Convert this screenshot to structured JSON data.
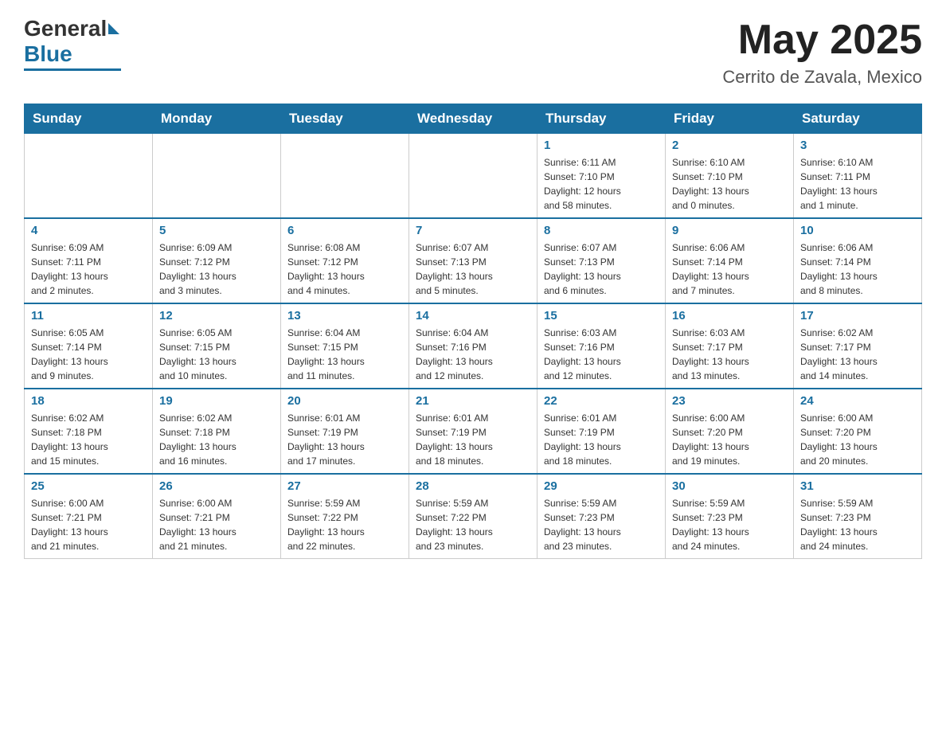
{
  "header": {
    "logo_general": "General",
    "logo_blue": "Blue",
    "month_year": "May 2025",
    "location": "Cerrito de Zavala, Mexico"
  },
  "days_of_week": [
    "Sunday",
    "Monday",
    "Tuesday",
    "Wednesday",
    "Thursday",
    "Friday",
    "Saturday"
  ],
  "weeks": [
    [
      {
        "day": "",
        "info": ""
      },
      {
        "day": "",
        "info": ""
      },
      {
        "day": "",
        "info": ""
      },
      {
        "day": "",
        "info": ""
      },
      {
        "day": "1",
        "info": "Sunrise: 6:11 AM\nSunset: 7:10 PM\nDaylight: 12 hours\nand 58 minutes."
      },
      {
        "day": "2",
        "info": "Sunrise: 6:10 AM\nSunset: 7:10 PM\nDaylight: 13 hours\nand 0 minutes."
      },
      {
        "day": "3",
        "info": "Sunrise: 6:10 AM\nSunset: 7:11 PM\nDaylight: 13 hours\nand 1 minute."
      }
    ],
    [
      {
        "day": "4",
        "info": "Sunrise: 6:09 AM\nSunset: 7:11 PM\nDaylight: 13 hours\nand 2 minutes."
      },
      {
        "day": "5",
        "info": "Sunrise: 6:09 AM\nSunset: 7:12 PM\nDaylight: 13 hours\nand 3 minutes."
      },
      {
        "day": "6",
        "info": "Sunrise: 6:08 AM\nSunset: 7:12 PM\nDaylight: 13 hours\nand 4 minutes."
      },
      {
        "day": "7",
        "info": "Sunrise: 6:07 AM\nSunset: 7:13 PM\nDaylight: 13 hours\nand 5 minutes."
      },
      {
        "day": "8",
        "info": "Sunrise: 6:07 AM\nSunset: 7:13 PM\nDaylight: 13 hours\nand 6 minutes."
      },
      {
        "day": "9",
        "info": "Sunrise: 6:06 AM\nSunset: 7:14 PM\nDaylight: 13 hours\nand 7 minutes."
      },
      {
        "day": "10",
        "info": "Sunrise: 6:06 AM\nSunset: 7:14 PM\nDaylight: 13 hours\nand 8 minutes."
      }
    ],
    [
      {
        "day": "11",
        "info": "Sunrise: 6:05 AM\nSunset: 7:14 PM\nDaylight: 13 hours\nand 9 minutes."
      },
      {
        "day": "12",
        "info": "Sunrise: 6:05 AM\nSunset: 7:15 PM\nDaylight: 13 hours\nand 10 minutes."
      },
      {
        "day": "13",
        "info": "Sunrise: 6:04 AM\nSunset: 7:15 PM\nDaylight: 13 hours\nand 11 minutes."
      },
      {
        "day": "14",
        "info": "Sunrise: 6:04 AM\nSunset: 7:16 PM\nDaylight: 13 hours\nand 12 minutes."
      },
      {
        "day": "15",
        "info": "Sunrise: 6:03 AM\nSunset: 7:16 PM\nDaylight: 13 hours\nand 12 minutes."
      },
      {
        "day": "16",
        "info": "Sunrise: 6:03 AM\nSunset: 7:17 PM\nDaylight: 13 hours\nand 13 minutes."
      },
      {
        "day": "17",
        "info": "Sunrise: 6:02 AM\nSunset: 7:17 PM\nDaylight: 13 hours\nand 14 minutes."
      }
    ],
    [
      {
        "day": "18",
        "info": "Sunrise: 6:02 AM\nSunset: 7:18 PM\nDaylight: 13 hours\nand 15 minutes."
      },
      {
        "day": "19",
        "info": "Sunrise: 6:02 AM\nSunset: 7:18 PM\nDaylight: 13 hours\nand 16 minutes."
      },
      {
        "day": "20",
        "info": "Sunrise: 6:01 AM\nSunset: 7:19 PM\nDaylight: 13 hours\nand 17 minutes."
      },
      {
        "day": "21",
        "info": "Sunrise: 6:01 AM\nSunset: 7:19 PM\nDaylight: 13 hours\nand 18 minutes."
      },
      {
        "day": "22",
        "info": "Sunrise: 6:01 AM\nSunset: 7:19 PM\nDaylight: 13 hours\nand 18 minutes."
      },
      {
        "day": "23",
        "info": "Sunrise: 6:00 AM\nSunset: 7:20 PM\nDaylight: 13 hours\nand 19 minutes."
      },
      {
        "day": "24",
        "info": "Sunrise: 6:00 AM\nSunset: 7:20 PM\nDaylight: 13 hours\nand 20 minutes."
      }
    ],
    [
      {
        "day": "25",
        "info": "Sunrise: 6:00 AM\nSunset: 7:21 PM\nDaylight: 13 hours\nand 21 minutes."
      },
      {
        "day": "26",
        "info": "Sunrise: 6:00 AM\nSunset: 7:21 PM\nDaylight: 13 hours\nand 21 minutes."
      },
      {
        "day": "27",
        "info": "Sunrise: 5:59 AM\nSunset: 7:22 PM\nDaylight: 13 hours\nand 22 minutes."
      },
      {
        "day": "28",
        "info": "Sunrise: 5:59 AM\nSunset: 7:22 PM\nDaylight: 13 hours\nand 23 minutes."
      },
      {
        "day": "29",
        "info": "Sunrise: 5:59 AM\nSunset: 7:23 PM\nDaylight: 13 hours\nand 23 minutes."
      },
      {
        "day": "30",
        "info": "Sunrise: 5:59 AM\nSunset: 7:23 PM\nDaylight: 13 hours\nand 24 minutes."
      },
      {
        "day": "31",
        "info": "Sunrise: 5:59 AM\nSunset: 7:23 PM\nDaylight: 13 hours\nand 24 minutes."
      }
    ]
  ]
}
